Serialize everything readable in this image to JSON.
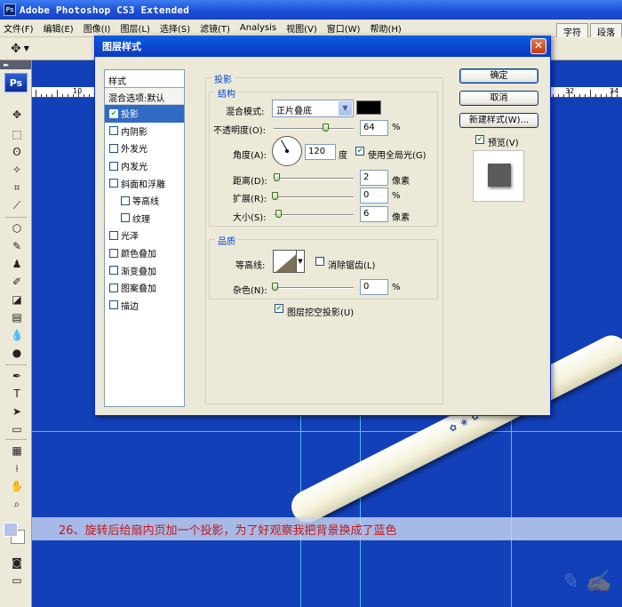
{
  "app": {
    "icon_text": "Ps",
    "title": "Adobe Photoshop CS3 Extended"
  },
  "menu": [
    "文件(F)",
    "编辑(E)",
    "图像(I)",
    "图层(L)",
    "选择(S)",
    "滤镜(T)",
    "Analysis",
    "视图(V)",
    "窗口(W)",
    "帮助(H)"
  ],
  "panel_tabs": [
    "字符",
    "段落"
  ],
  "options": {
    "tool": "move-tool",
    "arrow": "▼"
  },
  "toolbox": {
    "grip": "▸▸",
    "logo": "Ps"
  },
  "ruler": {
    "labels": [
      "10",
      "32",
      "34"
    ]
  },
  "dialog": {
    "title": "图层样式",
    "close": "✕",
    "styles_header": "样式",
    "blend_options": "混合选项:默认",
    "styles": [
      {
        "label": "投影",
        "checked": true,
        "selected": true,
        "indent": false
      },
      {
        "label": "内阴影",
        "checked": false,
        "selected": false,
        "indent": false
      },
      {
        "label": "外发光",
        "checked": false,
        "selected": false,
        "indent": false
      },
      {
        "label": "内发光",
        "checked": false,
        "selected": false,
        "indent": false
      },
      {
        "label": "斜面和浮雕",
        "checked": false,
        "selected": false,
        "indent": false
      },
      {
        "label": "等高线",
        "checked": false,
        "selected": false,
        "indent": true
      },
      {
        "label": "纹理",
        "checked": false,
        "selected": false,
        "indent": true
      },
      {
        "label": "光泽",
        "checked": false,
        "selected": false,
        "indent": false
      },
      {
        "label": "颜色叠加",
        "checked": false,
        "selected": false,
        "indent": false
      },
      {
        "label": "渐变叠加",
        "checked": false,
        "selected": false,
        "indent": false
      },
      {
        "label": "图案叠加",
        "checked": false,
        "selected": false,
        "indent": false
      },
      {
        "label": "描边",
        "checked": false,
        "selected": false,
        "indent": false
      }
    ],
    "drop_shadow_title": "投影",
    "structure": {
      "title": "结构",
      "blend_mode_label": "混合模式:",
      "blend_mode_value": "正片叠底",
      "shadow_color": "#000000",
      "opacity_label": "不透明度(O):",
      "opacity_value": "64",
      "opacity_unit": "%",
      "opacity_level": 0.64,
      "angle_label": "角度(A):",
      "angle_value": "120",
      "angle_unit": "度",
      "global_light_label": "使用全局光(G)",
      "global_light_checked": true,
      "distance_label": "距离(D):",
      "distance_value": "2",
      "distance_unit": "像素",
      "spread_label": "扩展(R):",
      "spread_value": "0",
      "spread_unit": "%",
      "size_label": "大小(S):",
      "size_value": "6",
      "size_unit": "像素"
    },
    "quality": {
      "title": "品质",
      "contour_label": "等高线:",
      "antialias_label": "消除锯齿(L)",
      "antialias_checked": false,
      "noise_label": "杂色(N):",
      "noise_value": "0",
      "noise_unit": "%",
      "knockout_label": "图层挖空投影(U)",
      "knockout_checked": true
    },
    "buttons": {
      "ok": "确定",
      "cancel": "取消",
      "new_style": "新建样式(W)..."
    },
    "preview_label": "预览(V)",
    "preview_checked": true
  },
  "caption": "26、旋转后给扇内页加一个投影，为了好观察我把背景换成了蓝色"
}
